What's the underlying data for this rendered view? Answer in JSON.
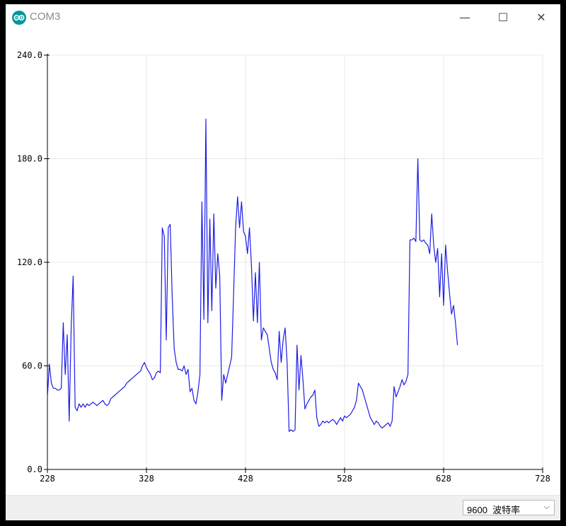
{
  "window": {
    "title": "COM3",
    "icon": "arduino-icon",
    "controls": {
      "minimize": "—",
      "maximize": "☐",
      "close": "✕"
    }
  },
  "footer": {
    "baud_value": "9600",
    "baud_unit": "波特率",
    "chevron": "⌵"
  },
  "colors": {
    "line": "#1c1ce8",
    "grid": "#e8e8e8",
    "axis": "#000000"
  },
  "chart_data": {
    "type": "line",
    "title": "",
    "xlabel": "",
    "ylabel": "",
    "xlim": [
      228,
      728
    ],
    "ylim": [
      0,
      240
    ],
    "x_ticks": [
      "228",
      "328",
      "428",
      "528",
      "628",
      "728"
    ],
    "y_ticks": [
      "0.0",
      "60.0",
      "120.0",
      "180.0",
      "240.0"
    ],
    "grid": true,
    "series": [
      {
        "x_start": 228,
        "x_step": 2,
        "values": [
          42,
          61,
          50,
          47,
          47,
          46,
          46,
          47,
          85,
          55,
          78,
          28,
          82,
          112,
          36,
          34,
          38,
          36,
          38,
          36,
          38,
          37,
          38,
          39,
          38,
          37,
          38,
          39,
          40,
          38,
          37,
          38,
          41,
          42,
          43,
          44,
          45,
          46,
          47,
          48,
          50,
          51,
          52,
          53,
          54,
          55,
          56,
          57,
          60,
          62,
          59,
          57,
          55,
          52,
          53,
          56,
          57,
          56,
          140,
          135,
          75,
          140,
          142,
          100,
          70,
          62,
          58,
          58,
          57,
          60,
          55,
          58,
          45,
          47,
          40,
          38,
          45,
          55,
          155,
          87,
          203,
          85,
          145,
          92,
          148,
          105,
          125,
          112,
          40,
          55,
          50,
          55,
          60,
          65,
          102,
          140,
          158,
          140,
          155,
          138,
          135,
          125,
          140,
          118,
          86,
          114,
          85,
          120,
          75,
          82,
          80,
          78,
          70,
          62,
          58,
          56,
          52,
          80,
          62,
          75,
          82,
          62,
          22,
          23,
          22,
          23,
          72,
          46,
          66,
          52,
          35,
          38,
          40,
          42,
          43,
          46,
          30,
          25,
          26,
          28,
          27,
          28,
          27,
          28,
          29,
          28,
          26,
          28,
          30,
          28,
          31,
          30,
          31,
          32,
          34,
          36,
          40,
          50,
          48,
          46,
          42,
          38,
          34,
          30,
          28,
          26,
          28,
          27,
          25,
          24,
          25,
          26,
          27,
          25,
          28,
          48,
          42,
          45,
          48,
          52,
          49,
          51,
          55,
          133,
          133,
          134,
          132,
          180,
          133,
          132,
          133,
          131,
          130,
          125,
          148,
          130,
          120,
          128,
          100,
          125,
          95,
          130,
          115,
          102,
          90,
          95,
          85,
          72
        ]
      }
    ]
  }
}
